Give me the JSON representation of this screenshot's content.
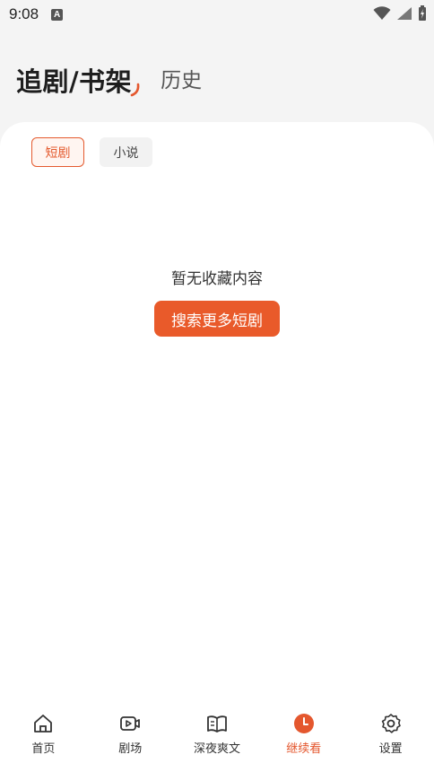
{
  "status_bar": {
    "time": "9:08",
    "notification_icon": "A"
  },
  "header": {
    "tab_main": "追剧/书架",
    "tab_history": "历史"
  },
  "filter_chips": [
    {
      "label": "短剧",
      "active": true
    },
    {
      "label": "小说",
      "active": false
    }
  ],
  "empty_state": {
    "message": "暂无收藏内容",
    "button_label": "搜索更多短剧"
  },
  "bottom_nav": {
    "items": [
      {
        "label": "首页",
        "icon": "home-icon",
        "active": false
      },
      {
        "label": "剧场",
        "icon": "video-play-icon",
        "active": false
      },
      {
        "label": "深夜爽文",
        "icon": "book-icon",
        "active": false
      },
      {
        "label": "继续看",
        "icon": "clock-icon",
        "active": true
      },
      {
        "label": "设置",
        "icon": "gear-icon",
        "active": false
      }
    ]
  },
  "colors": {
    "accent": "#e95a2a",
    "background": "#f4f4f4",
    "card": "#ffffff"
  }
}
